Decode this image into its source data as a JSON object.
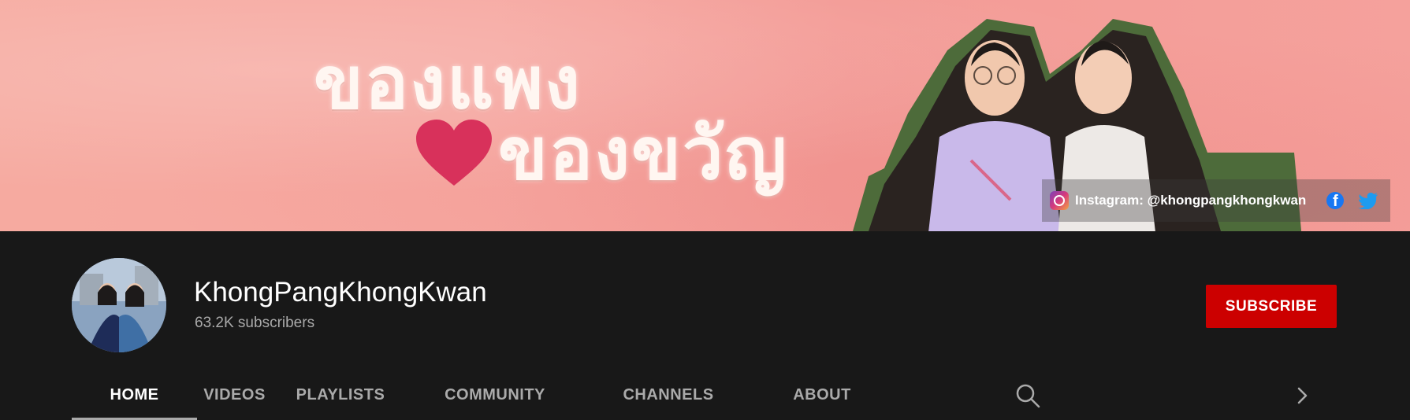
{
  "banner": {
    "title_line1": "ของแพง",
    "title_line2": "ของขวัญ",
    "heart_icon": "heart-icon",
    "instagram_text": "Instagram: @khongpangkhongkwan",
    "social_icons": [
      "instagram-icon",
      "facebook-icon",
      "twitter-icon"
    ]
  },
  "channel": {
    "name": "KhongPangKhongKwan",
    "subscribers": "63.2K subscribers",
    "subscribe_label": "SUBSCRIBE"
  },
  "tabs": [
    {
      "label": "HOME",
      "active": true
    },
    {
      "label": "VIDEOS",
      "active": false
    },
    {
      "label": "PLAYLISTS",
      "active": false
    },
    {
      "label": "COMMUNITY",
      "active": false
    },
    {
      "label": "CHANNELS",
      "active": false
    },
    {
      "label": "ABOUT",
      "active": false
    }
  ],
  "icons": {
    "search": "search-icon",
    "next": "chevron-right-icon"
  },
  "colors": {
    "background": "#181818",
    "subscribe": "#cc0000",
    "heart": "#d8315b",
    "banner": "#f6a7a0"
  }
}
